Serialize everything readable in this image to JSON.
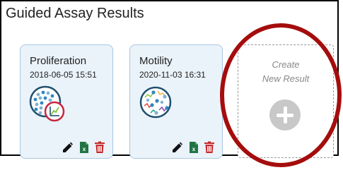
{
  "panel": {
    "title": "Guided Assay Results"
  },
  "results": [
    {
      "name": "Proliferation",
      "timestamp": "2018-06-05 15:51",
      "icon": "proliferation-assay-icon"
    },
    {
      "name": "Motility",
      "timestamp": "2020-11-03 16:31",
      "icon": "motility-assay-icon"
    }
  ],
  "actions": {
    "edit_icon": "pencil-icon",
    "export_icon": "excel-icon",
    "delete_icon": "trash-icon"
  },
  "create": {
    "line1": "Create",
    "line2": "New Result",
    "icon": "plus-circle-icon"
  },
  "colors": {
    "card_bg": "#eaf3fa",
    "card_border": "#a9c6e0",
    "excel_green": "#217346",
    "delete_red": "#c62828",
    "highlight_ring": "#a50d0d",
    "plus_gray": "#c8c8c8"
  }
}
